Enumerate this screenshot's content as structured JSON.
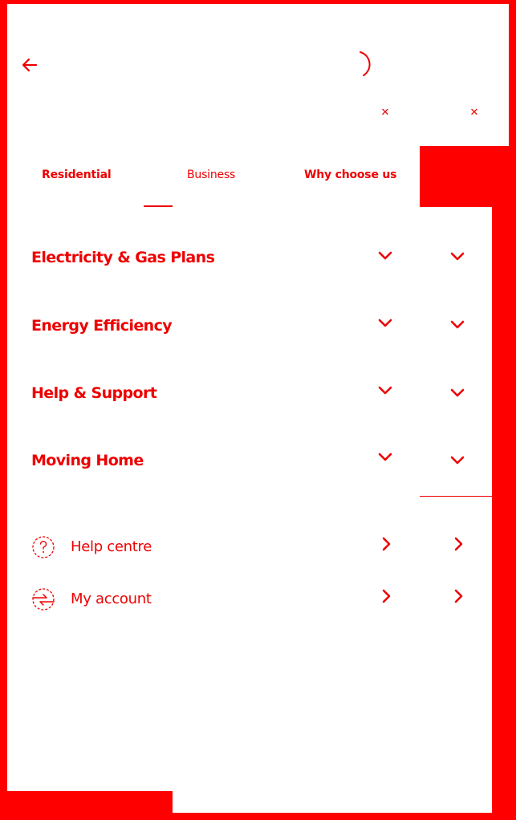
{
  "header": {
    "back_icon": "arrow-left-icon",
    "spinner_icon": "loading-spinner-icon",
    "close_icons": [
      "close-icon",
      "close-icon"
    ]
  },
  "tabs": [
    {
      "label": "Residential"
    },
    {
      "label": "Business"
    },
    {
      "label": "Why choose us"
    }
  ],
  "accordion": [
    {
      "label": "Electricity & Gas Plans"
    },
    {
      "label": "Energy Efficiency"
    },
    {
      "label": "Help & Support"
    },
    {
      "label": "Moving Home"
    }
  ],
  "links": [
    {
      "label": "Help centre",
      "icon": "help-circle-icon"
    },
    {
      "label": "My account",
      "icon": "account-switch-icon"
    }
  ],
  "colors": {
    "accent": "#ee0000",
    "background": "#ffffff",
    "frame": "#ff0000"
  }
}
